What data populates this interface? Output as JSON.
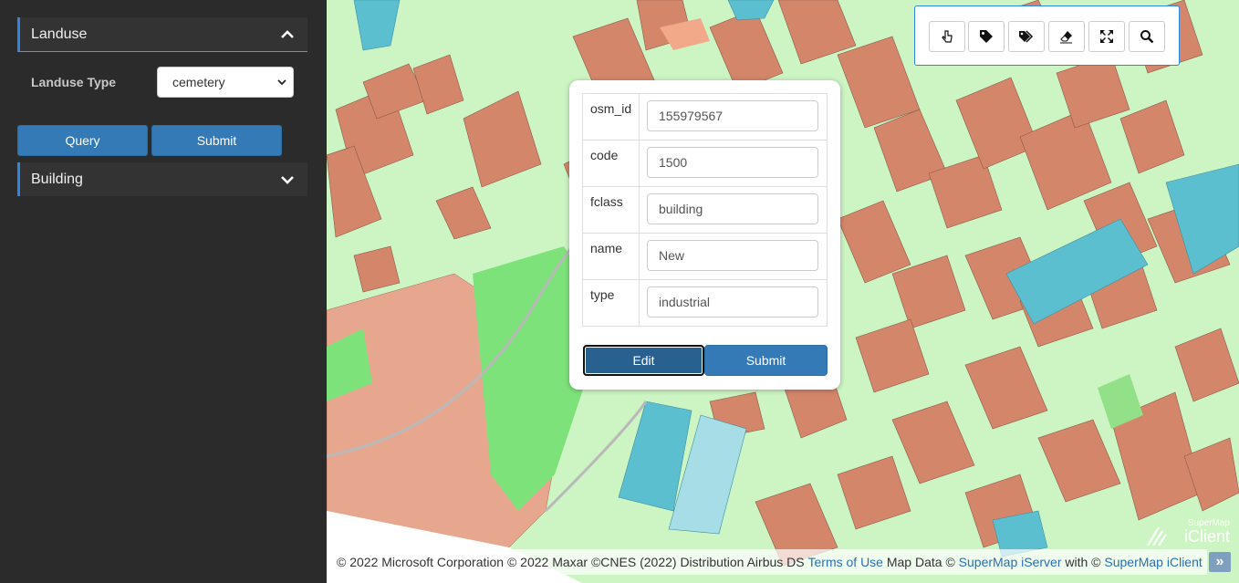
{
  "sidebar": {
    "landuse": {
      "title": "Landuse",
      "type_label": "Landuse Type",
      "type_value": "cemetery",
      "query_label": "Query",
      "submit_label": "Submit"
    },
    "building": {
      "title": "Building"
    }
  },
  "toolbar": {
    "tools": [
      "pointer-select-icon",
      "tag-icon",
      "tags-icon",
      "eraser-icon",
      "fullscreen-icon",
      "search-icon"
    ]
  },
  "popup": {
    "rows": [
      {
        "key": "osm_id",
        "value": "155979567"
      },
      {
        "key": "code",
        "value": "1500"
      },
      {
        "key": "fclass",
        "value": "building"
      },
      {
        "key": "name",
        "value": "New"
      },
      {
        "key": "type",
        "value": "industrial"
      }
    ],
    "edit_label": "Edit",
    "submit_label": "Submit"
  },
  "attribution": {
    "prefix": "© 2022 Microsoft Corporation © 2022 Maxar ©CNES (2022) Distribution Airbus DS",
    "terms": "Terms of Use",
    "mapdata": "Map Data ©",
    "iserver": "SuperMap iServer",
    "with": "with ©",
    "iclient": "SuperMap iClient",
    "toggle": "»"
  },
  "logo": {
    "small": "SuperMap",
    "big": "iClient"
  },
  "colors": {
    "accent": "#337ab7",
    "building": "#d4866a",
    "landuse": "#cdf5c4",
    "water": "#5bbfd0",
    "park": "#7ee27a"
  }
}
